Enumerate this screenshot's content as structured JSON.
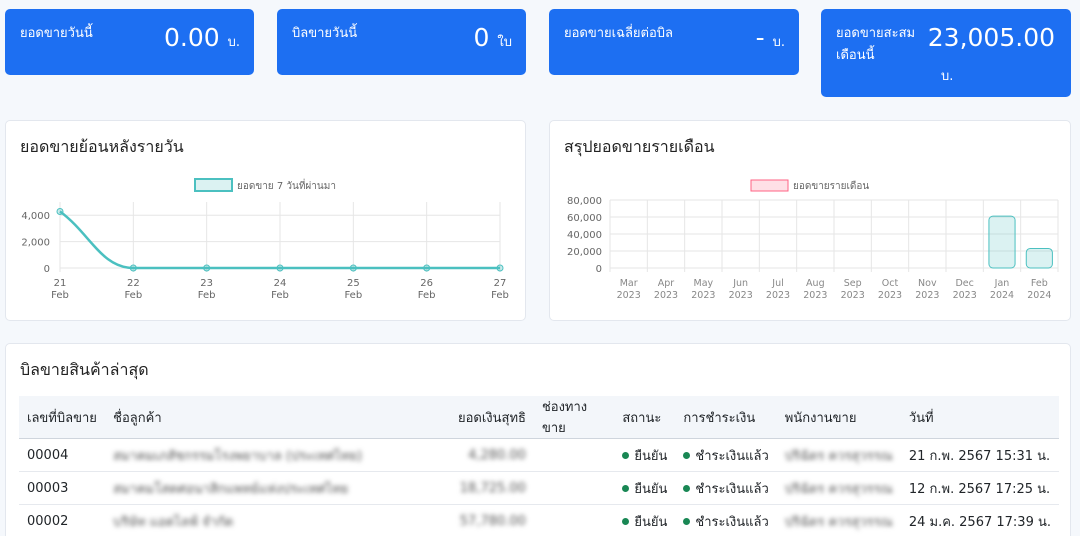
{
  "stats": {
    "today_sales": {
      "label": "ยอดขายวันนี้",
      "value": "0.00",
      "unit": "บ."
    },
    "today_bills": {
      "label": "บิลขายวันนี้",
      "value": "0",
      "unit": "ใบ"
    },
    "avg_per_bill": {
      "label": "ยอดขายเฉลี่ยต่อบิล",
      "value": "-",
      "unit": "บ."
    },
    "month_total": {
      "label": "ยอดขายสะสมเดือนนี้",
      "value": "23,005.00",
      "unit": "บ."
    }
  },
  "daily_card": {
    "title": "ยอดขายย้อนหลังรายวัน"
  },
  "monthly_card": {
    "title": "สรุปยอดขายรายเดือน"
  },
  "chart_data": [
    {
      "type": "line",
      "legend": "ยอดขาย 7 วันที่ผ่านมา",
      "legend_position": "top",
      "categories": [
        [
          "21",
          "Feb"
        ],
        [
          "22",
          "Feb"
        ],
        [
          "23",
          "Feb"
        ],
        [
          "24",
          "Feb"
        ],
        [
          "25",
          "Feb"
        ],
        [
          "26",
          "Feb"
        ],
        [
          "27",
          "Feb"
        ]
      ],
      "values": [
        4280,
        0,
        0,
        0,
        0,
        0,
        0
      ],
      "ylim": [
        0,
        5000
      ],
      "yticks": [
        "0",
        "2,000",
        "4,000"
      ],
      "color": "#4bc0c0",
      "grid": true
    },
    {
      "type": "bar",
      "legend": "ยอดขายรายเดือน",
      "legend_position": "top",
      "categories": [
        [
          "Mar",
          "2023"
        ],
        [
          "Apr",
          "2023"
        ],
        [
          "May",
          "2023"
        ],
        [
          "Jun",
          "2023"
        ],
        [
          "Jul",
          "2023"
        ],
        [
          "Aug",
          "2023"
        ],
        [
          "Sep",
          "2023"
        ],
        [
          "Oct",
          "2023"
        ],
        [
          "Nov",
          "2023"
        ],
        [
          "Dec",
          "2023"
        ],
        [
          "Jan",
          "2024"
        ],
        [
          "Feb",
          "2024"
        ]
      ],
      "values": [
        0,
        0,
        0,
        0,
        0,
        0,
        0,
        0,
        0,
        0,
        61000,
        23005
      ],
      "ylim": [
        0,
        80000
      ],
      "yticks": [
        "0",
        "20,000",
        "40,000",
        "60,000",
        "80,000"
      ],
      "legend_color": "#ff6384",
      "bar_color": "#4bc0c0",
      "grid": true
    }
  ],
  "recent_bills": {
    "title": "บิลขายสินค้าล่าสุด",
    "headers": [
      "เลขที่บิลขาย",
      "ชื่อลูกค้า",
      "ยอดเงินสุทธิ",
      "ช่องทางขาย",
      "สถานะ",
      "การชำระเงิน",
      "พนักงานขาย",
      "วันที่"
    ],
    "rows": [
      {
        "bill": "00004",
        "customer": "สมาคมเภสัชกรรมโรงพยาบาล (ประเทศไทย)",
        "amount": "4,280.00",
        "channel": "",
        "status": "ยืนยัน",
        "payment": "ชำระเงินแล้ว",
        "staff": "ปริฉัตร ควรสุวรรณ",
        "date": "21 ก.พ. 2567 15:31 น."
      },
      {
        "bill": "00003",
        "customer": "สมาคมโสตศอนาสิกแพทย์แห่งประเทศไทย",
        "amount": "18,725.00",
        "channel": "",
        "status": "ยืนยัน",
        "payment": "ชำระเงินแล้ว",
        "staff": "ปริฉัตร ควรสุวรรณ",
        "date": "12 ก.พ. 2567 17:25 น."
      },
      {
        "bill": "00002",
        "customer": "บริษัท แอดไลฟ์ จำกัด",
        "amount": "57,780.00",
        "channel": "",
        "status": "ยืนยัน",
        "payment": "ชำระเงินแล้ว",
        "staff": "ปริฉัตร ควรสุวรรณ",
        "date": "24 ม.ค. 2567 17:39 น."
      }
    ]
  }
}
